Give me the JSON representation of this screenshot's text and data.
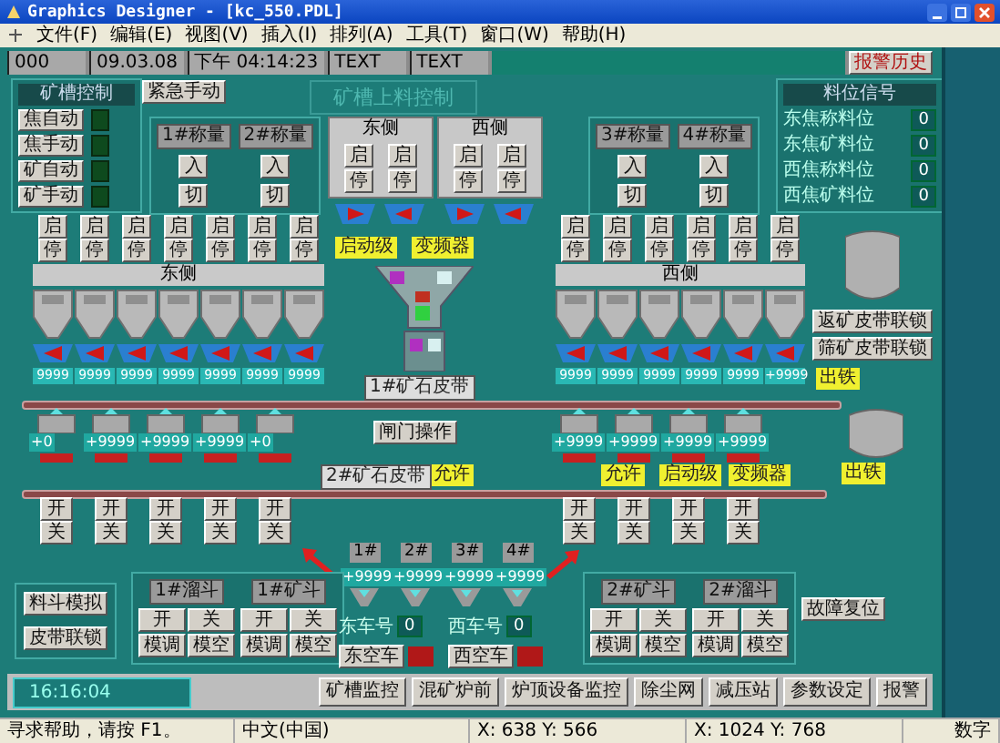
{
  "window": {
    "title": "Graphics Designer - [kc_550.PDL]"
  },
  "menu": [
    "文件(F)",
    "编辑(E)",
    "视图(V)",
    "插入(I)",
    "排列(A)",
    "工具(T)",
    "窗口(W)",
    "帮助(H)"
  ],
  "header": {
    "fields": [
      "000",
      "09.03.08",
      "下午 04:14:23",
      "TEXT",
      "TEXT"
    ],
    "alarm_button": "报警历史"
  },
  "control_panel": {
    "title": "矿槽控制",
    "buttons": [
      "焦自动",
      "焦手动",
      "矿自动",
      "矿手动"
    ]
  },
  "manual_button": "紧急手动",
  "title": "矿槽上料控制",
  "weigh_groups": [
    {
      "title": "1#称量",
      "in": "入",
      "cut": "切"
    },
    {
      "title": "2#称量",
      "in": "入",
      "cut": "切"
    },
    {
      "title": "3#称量",
      "in": "入",
      "cut": "切"
    },
    {
      "title": "4#称量",
      "in": "入",
      "cut": "切"
    }
  ],
  "signal_panel": {
    "title": "料位信号",
    "rows": [
      {
        "label": "东焦称料位",
        "value": "0"
      },
      {
        "label": "东焦矿料位",
        "value": "0"
      },
      {
        "label": "西焦称料位",
        "value": "0"
      },
      {
        "label": "西焦矿料位",
        "value": "0"
      }
    ]
  },
  "top_bins": [
    {
      "label": "东侧",
      "bins": [
        {
          "start": "启",
          "stop": "停"
        },
        {
          "start": "启",
          "stop": "停"
        }
      ]
    },
    {
      "label": "西侧",
      "bins": [
        {
          "start": "启",
          "stop": "停"
        },
        {
          "start": "启",
          "stop": "停"
        }
      ]
    }
  ],
  "ore_bins": {
    "left_label": "东侧",
    "right_label": "西侧",
    "left": [
      {
        "start": "启",
        "stop": "停",
        "reading": "9999"
      },
      {
        "start": "启",
        "stop": "停",
        "reading": "9999"
      },
      {
        "start": "启",
        "stop": "停",
        "reading": "9999"
      },
      {
        "start": "启",
        "stop": "停",
        "reading": "9999"
      },
      {
        "start": "启",
        "stop": "停",
        "reading": "9999"
      },
      {
        "start": "启",
        "stop": "停",
        "reading": "9999"
      },
      {
        "start": "启",
        "stop": "停",
        "reading": "9999"
      }
    ],
    "right": [
      {
        "start": "启",
        "stop": "停",
        "reading": "9999"
      },
      {
        "start": "启",
        "stop": "停",
        "reading": "9999"
      },
      {
        "start": "启",
        "stop": "停",
        "reading": "9999"
      },
      {
        "start": "启",
        "stop": "停",
        "reading": "9999"
      },
      {
        "start": "启",
        "stop": "停",
        "reading": "9999"
      },
      {
        "start": "启",
        "stop": "停",
        "reading": "+9999"
      }
    ]
  },
  "weigh_hoppers": {
    "left": [
      {
        "value": "+0",
        "open": "开",
        "close": "关"
      },
      {
        "value": "+9999",
        "open": "开",
        "close": "关"
      },
      {
        "value": "+9999",
        "open": "开",
        "close": "关"
      },
      {
        "value": "+9999",
        "open": "开",
        "close": "关"
      },
      {
        "value": "+0",
        "open": "开",
        "close": "关"
      }
    ],
    "right": [
      {
        "value": "+9999",
        "open": "开",
        "close": "关"
      },
      {
        "value": "+9999",
        "open": "开",
        "close": "关"
      },
      {
        "value": "+9999",
        "open": "开",
        "close": "关"
      },
      {
        "value": "+9999",
        "open": "开",
        "close": "关"
      }
    ]
  },
  "gate_button": "闸门操作",
  "belt_labels": [
    "1#矿石皮带",
    "2#矿石皮带"
  ],
  "tags": [
    "启动级",
    "变频器",
    "出铁",
    "允许",
    "允许",
    "启动级",
    "变频器",
    "出铁"
  ],
  "side_buttons": [
    "返矿皮带联锁",
    "筛矿皮带联锁"
  ],
  "small_hoppers": [
    {
      "title": "1#",
      "value": "+9999"
    },
    {
      "title": "2#",
      "value": "+9999"
    },
    {
      "title": "3#",
      "value": "+9999"
    },
    {
      "title": "4#",
      "value": "+9999"
    }
  ],
  "chute_groups": [
    {
      "title": "1#溜斗",
      "buttons": [
        "开",
        "关",
        "模调",
        "模空"
      ]
    },
    {
      "title": "1#矿斗",
      "buttons": [
        "开",
        "关",
        "模调",
        "模空"
      ]
    },
    {
      "title": "2#矿斗",
      "buttons": [
        "开",
        "关",
        "模调",
        "模空"
      ]
    },
    {
      "title": "2#溜斗",
      "buttons": [
        "开",
        "关",
        "模调",
        "模空"
      ]
    }
  ],
  "sim_buttons": [
    "料斗模拟",
    "皮带联锁"
  ],
  "cars": [
    {
      "label": "东车号",
      "value": "0",
      "button": "东空车"
    },
    {
      "label": "西车号",
      "value": "0",
      "button": "西空车"
    }
  ],
  "reset_button": "故障复位",
  "clock": "16:16:04",
  "nav_buttons": [
    "矿槽监控",
    "混矿炉前",
    "炉顶设备监控",
    "除尘网",
    "减压站",
    "参数设定",
    "报警"
  ],
  "status_bar": [
    "寻求帮助，请按 F1。",
    "中文(中国)",
    "X: 638 Y: 566",
    "X: 1024 Y: 768",
    "数字"
  ]
}
